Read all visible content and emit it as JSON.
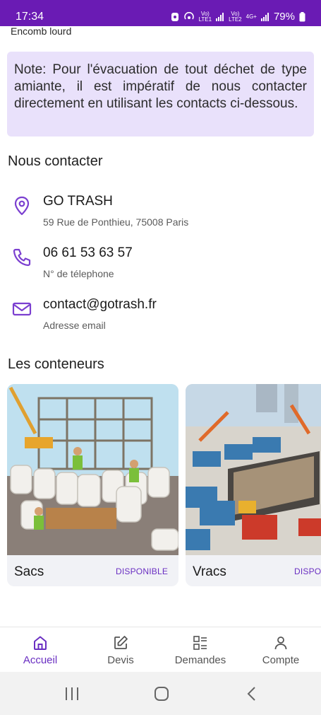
{
  "status": {
    "time": "17:34",
    "battery": "79%",
    "lte1": "LTE1",
    "lte2": "LTE2",
    "g4": "4G+",
    "volte": "Vo)"
  },
  "header_cut": "Encomb lourd",
  "note": "Note: Pour l'évacuation de tout déchet de type amiante, il est impératif de nous contacter directement en utilisant les contacts ci-dessous.",
  "contact_section": {
    "title": "Nous contacter",
    "items": [
      {
        "icon": "location-pin-icon",
        "main": "GO TRASH",
        "sub": "59 Rue de Ponthieu, 75008 Paris"
      },
      {
        "icon": "phone-icon",
        "main": "06 61 53 63 57",
        "sub": "N° de télephone"
      },
      {
        "icon": "mail-icon",
        "main": "contact@gotrash.fr",
        "sub": "Adresse email"
      }
    ]
  },
  "containers_section": {
    "title": "Les conteneurs",
    "cards": [
      {
        "name": "Sacs",
        "badge": "DISPONIBLE"
      },
      {
        "name": "Vracs",
        "badge": "DISPONIBLE"
      }
    ]
  },
  "bottom_nav": [
    {
      "label": "Accueil",
      "icon": "home-icon",
      "active": true
    },
    {
      "label": "Devis",
      "icon": "edit-icon",
      "active": false
    },
    {
      "label": "Demandes",
      "icon": "list-icon",
      "active": false
    },
    {
      "label": "Compte",
      "icon": "user-icon",
      "active": false
    }
  ],
  "colors": {
    "accent": "#6a2fc2",
    "statusbar": "#6a1bb4",
    "note_bg": "#e9e1fb"
  }
}
